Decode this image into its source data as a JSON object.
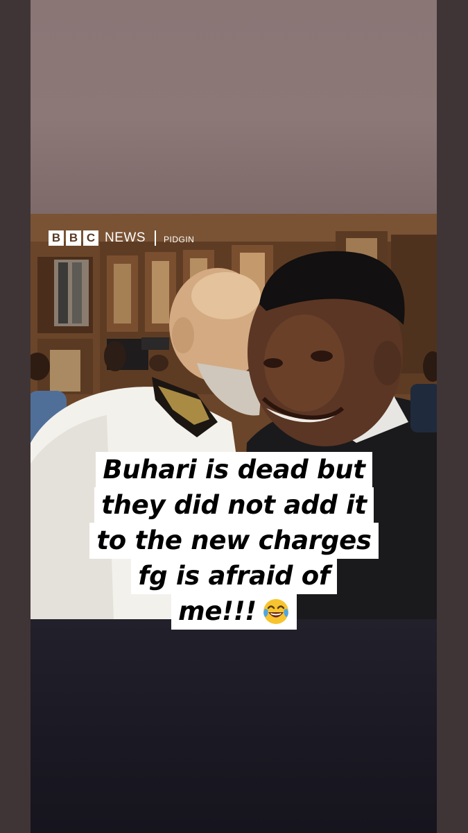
{
  "watermark": {
    "blocks": [
      "B",
      "B",
      "C"
    ],
    "brand": "NEWS",
    "sub": "PIDGIN"
  },
  "caption": {
    "lines": [
      "Buhari is dead but",
      "they did not add it",
      "to the new charges",
      "fg is afraid of",
      "me!!!"
    ],
    "emoji": "tears-of-joy-emoji-icon"
  },
  "colors": {
    "top_band": "#8b7877",
    "bottom_band": "#1b1923",
    "outer_bars": "#3f3536",
    "caption_bg": "#ffffff",
    "caption_text": "#000000"
  }
}
